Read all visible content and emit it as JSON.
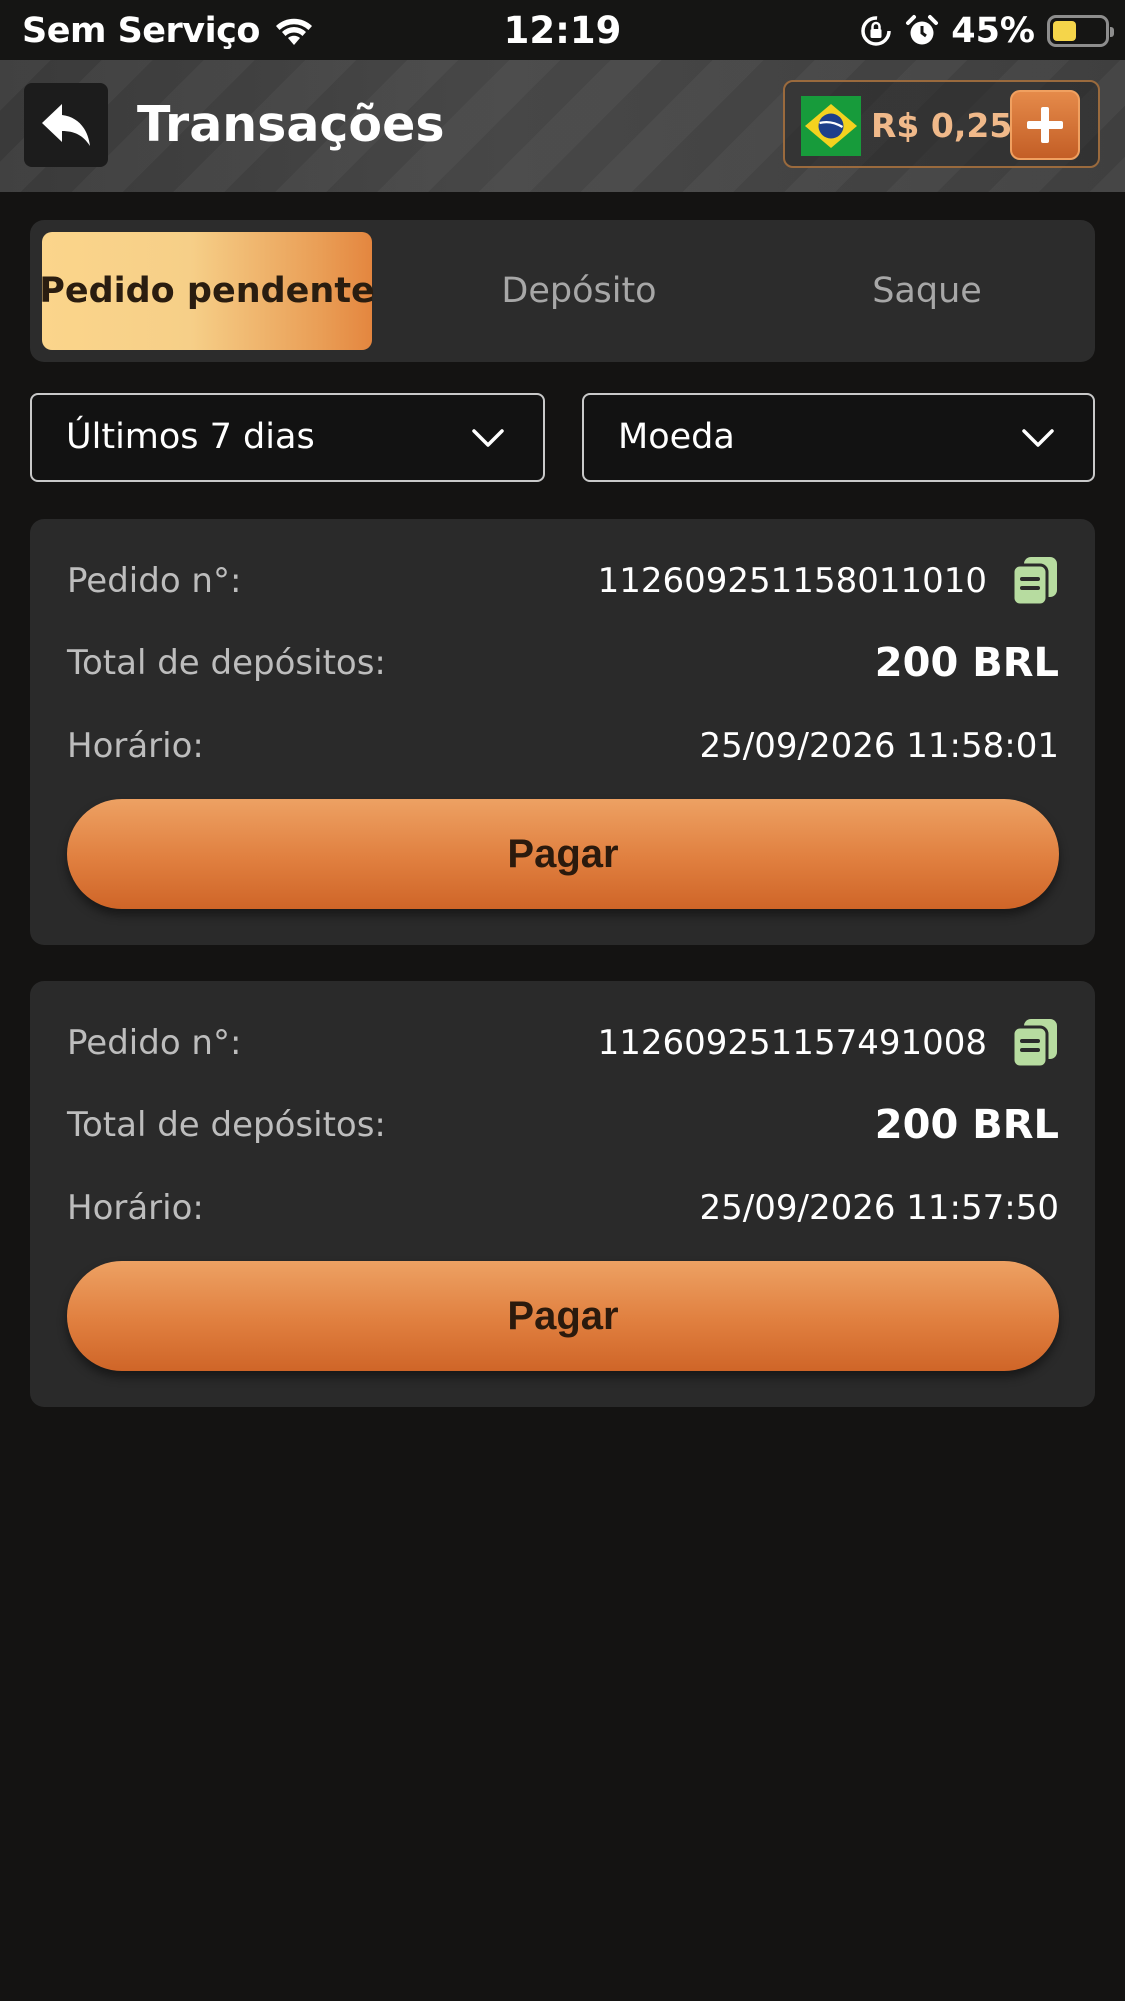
{
  "status_bar": {
    "carrier": "Sem Serviço",
    "time": "12:19",
    "battery_percent": "45%",
    "battery_level": 0.45,
    "icons": [
      "wifi-icon",
      "orientation-lock-icon",
      "alarm-icon",
      "battery-icon"
    ]
  },
  "header": {
    "title": "Transações",
    "back_icon": "back-arrow-icon",
    "balance": "R$ 0,25",
    "flag_icon": "brazil-flag-icon",
    "add_icon": "plus-icon"
  },
  "tabs": [
    {
      "label": "Pedido pendente",
      "active": true
    },
    {
      "label": "Depósito",
      "active": false
    },
    {
      "label": "Saque",
      "active": false
    }
  ],
  "filters": {
    "period": "Últimos 7 dias",
    "currency": "Moeda"
  },
  "labels": {
    "order_no": "Pedido n°:",
    "total_deposits": "Total de depósitos:",
    "time": "Horário:",
    "pay": "Pagar"
  },
  "orders": [
    {
      "order_no": "112609251158011010",
      "total": "200 BRL",
      "time": "25/09/2026 11:58:01"
    },
    {
      "order_no": "112609251157491008",
      "total": "200 BRL",
      "time": "25/09/2026 11:57:50"
    }
  ],
  "colors": {
    "accent": "#e0803f",
    "tab_active_start": "#fbd58b",
    "tab_active_end": "#e4863f",
    "balance_text": "#f0b98a",
    "copy_icon": "#b7dca0",
    "battery": "#f5d54a"
  }
}
